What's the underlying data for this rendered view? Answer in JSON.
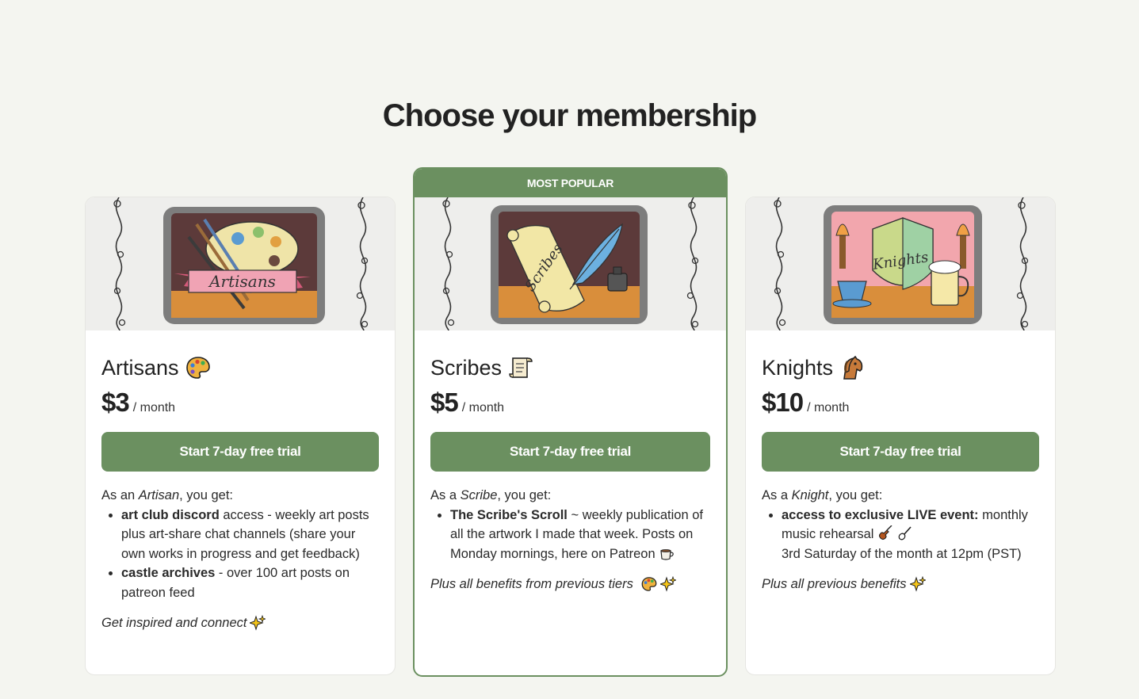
{
  "page": {
    "title": "Choose your membership"
  },
  "colors": {
    "accent": "#6b9060",
    "background": "#f4f5f0"
  },
  "tiers": [
    {
      "name": "Artisans",
      "emoji_icon": "palette-icon",
      "price": "$3",
      "period": "/ month",
      "cta": "Start 7-day free trial",
      "banner_label": "Artisans",
      "intro_pre": "As an ",
      "intro_role": "Artisan",
      "intro_post": ", you get:",
      "benefits": [
        {
          "bold": "art club discord",
          "text": " access - weekly art posts plus art-share chat channels (share your own works in progress and get feedback)"
        },
        {
          "bold": "castle archives",
          "text": " - over 100 art posts on patreon feed"
        }
      ],
      "footer": "Get inspired and connect"
    },
    {
      "name": "Scribes",
      "emoji_icon": "scroll-icon",
      "price": "$5",
      "period": "/ month",
      "cta": "Start 7-day free trial",
      "badge": "MOST POPULAR",
      "banner_label": "Scribes",
      "intro_pre": "As a ",
      "intro_role": "Scribe",
      "intro_post": ", you get:",
      "benefits": [
        {
          "bold": "The Scribe's Scroll",
          "text": " ~ weekly publication of all the artwork I made that week. Posts on Monday mornings, here on Patreon"
        }
      ],
      "footer": "Plus all benefits from previous tiers"
    },
    {
      "name": "Knights",
      "emoji_icon": "horse-icon",
      "price": "$10",
      "period": "/ month",
      "cta": "Start 7-day free trial",
      "banner_label": "Knights",
      "intro_pre": "As a ",
      "intro_role": "Knight",
      "intro_post": ", you get:",
      "benefits": [
        {
          "bold": "access to exclusive LIVE event:",
          "text": " monthly music rehearsal",
          "extra": "3rd Saturday of the month at 12pm (PST)"
        }
      ],
      "footer": "Plus all previous benefits"
    }
  ]
}
